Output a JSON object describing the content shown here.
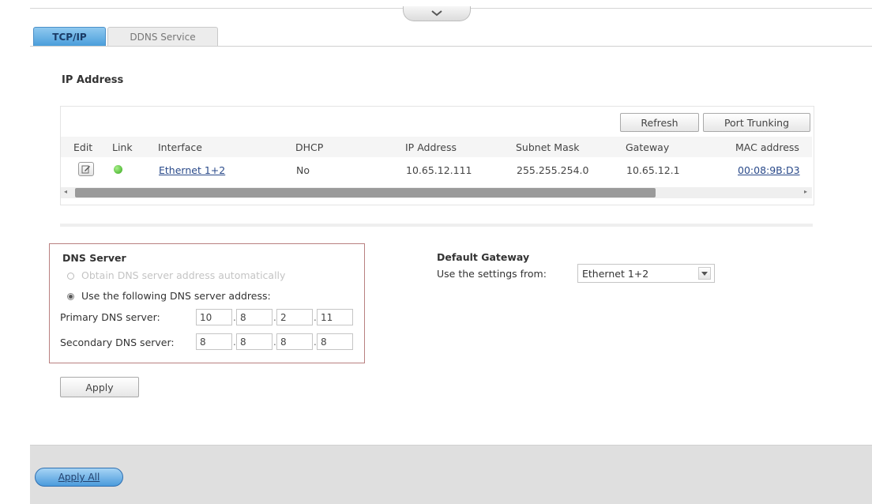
{
  "tabs": [
    {
      "label": "TCP/IP",
      "active": true
    },
    {
      "label": "DDNS Service",
      "active": false
    }
  ],
  "ip_section": {
    "title": "IP Address",
    "buttons": {
      "refresh": "Refresh",
      "port_trunking": "Port Trunking"
    },
    "columns": [
      "Edit",
      "Link",
      "Interface",
      "DHCP",
      "IP Address",
      "Subnet Mask",
      "Gateway",
      "MAC address"
    ],
    "rows": [
      {
        "link_status_color": "#38a81e",
        "interface": "Ethernet 1+2",
        "dhcp": "No",
        "ip_address": "10.65.12.111",
        "subnet_mask": "255.255.254.0",
        "gateway": "10.65.12.1",
        "mac_address": "00:08:9B:D3"
      }
    ]
  },
  "dns_server": {
    "title": "DNS Server",
    "option_auto": "Obtain DNS server address automatically",
    "option_manual": "Use the following DNS server address:",
    "selected": "manual",
    "primary_label": "Primary DNS server:",
    "primary": [
      "10",
      "8",
      "2",
      "11"
    ],
    "secondary_label": "Secondary DNS server:",
    "secondary": [
      "8",
      "8",
      "8",
      "8"
    ],
    "apply_label": "Apply"
  },
  "default_gateway": {
    "title": "Default Gateway",
    "label": "Use the settings from:",
    "selected": "Ethernet 1+2"
  },
  "footer": {
    "apply_all_label": "Apply All"
  },
  "colors": {
    "accent": "#4a9edb",
    "dns_border": "#b98080"
  }
}
